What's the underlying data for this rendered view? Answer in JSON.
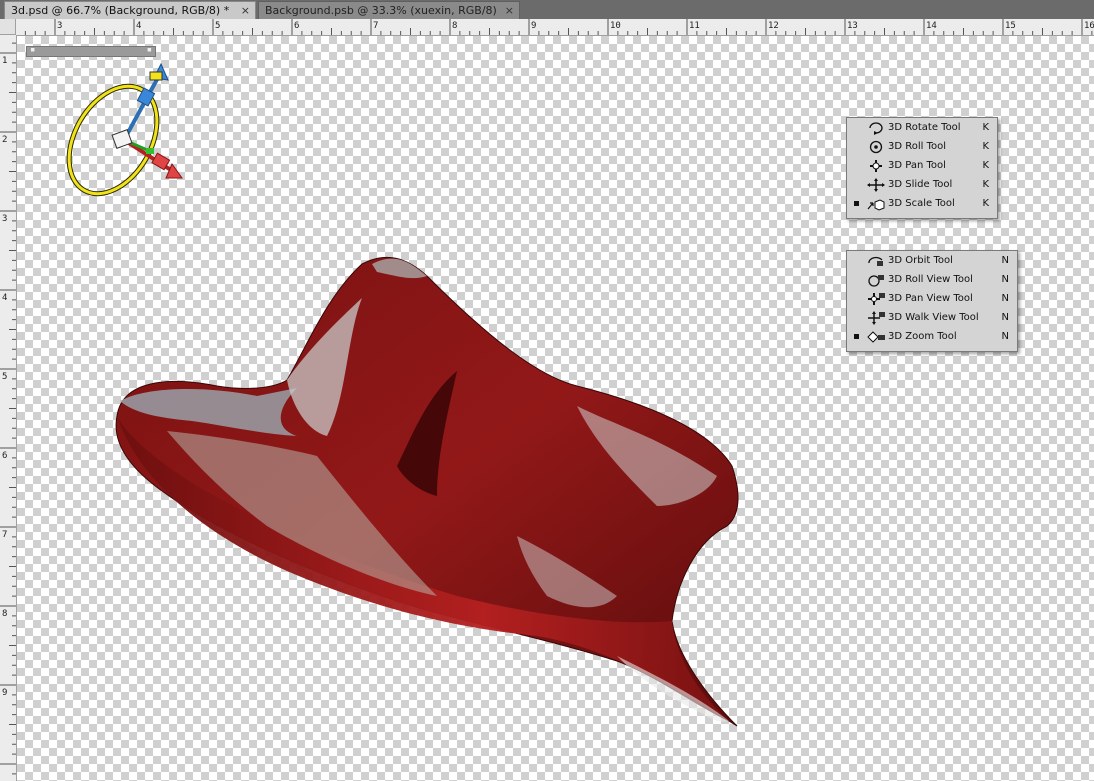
{
  "tabs": [
    {
      "label": "3d.psd @ 66.7% (Background, RGB/8) *",
      "active": true
    },
    {
      "label": "Background.psb @ 33.3% (xuexin, RGB/8)",
      "active": false
    }
  ],
  "tab_close_glyph": "×",
  "ruler": {
    "top_labels": [
      "3",
      "4",
      "5",
      "6",
      "7",
      "8",
      "9",
      "10",
      "11",
      "12",
      "13",
      "14",
      "15",
      "16"
    ],
    "left_labels": [
      "1",
      "2",
      "3",
      "4",
      "5",
      "6",
      "7",
      "8",
      "9"
    ]
  },
  "object_tools_menu": {
    "items": [
      {
        "label": "3D Rotate Tool",
        "shortcut": "K",
        "icon": "rotate-3d-icon",
        "selected": false
      },
      {
        "label": "3D Roll Tool",
        "shortcut": "K",
        "icon": "roll-3d-icon",
        "selected": false
      },
      {
        "label": "3D Pan Tool",
        "shortcut": "K",
        "icon": "pan-3d-icon",
        "selected": false
      },
      {
        "label": "3D Slide Tool",
        "shortcut": "K",
        "icon": "slide-3d-icon",
        "selected": false
      },
      {
        "label": "3D Scale Tool",
        "shortcut": "K",
        "icon": "scale-3d-icon",
        "selected": true
      }
    ]
  },
  "camera_tools_menu": {
    "items": [
      {
        "label": "3D Orbit Tool",
        "shortcut": "N",
        "icon": "orbit-camera-icon",
        "selected": false
      },
      {
        "label": "3D Roll View Tool",
        "shortcut": "N",
        "icon": "roll-view-camera-icon",
        "selected": false
      },
      {
        "label": "3D Pan View Tool",
        "shortcut": "N",
        "icon": "pan-view-camera-icon",
        "selected": false
      },
      {
        "label": "3D Walk View Tool",
        "shortcut": "N",
        "icon": "walk-view-camera-icon",
        "selected": false
      },
      {
        "label": "3D Zoom Tool",
        "shortcut": "N",
        "icon": "zoom-camera-icon",
        "selected": true
      }
    ]
  },
  "axis_widget": {
    "icon": "3d-axis-widget-icon"
  },
  "colors": {
    "hat_red": "#8c1616",
    "hat_dark": "#4a0808",
    "ring_yellow": "#f2e21a"
  }
}
